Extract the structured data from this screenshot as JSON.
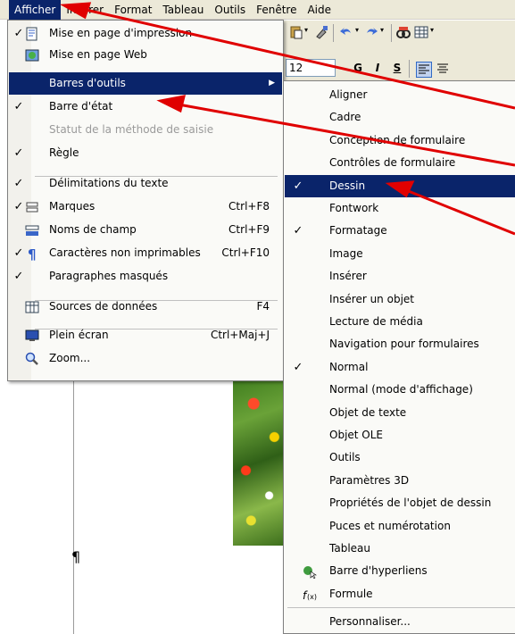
{
  "menubar": [
    "Afficher",
    "Insérer",
    "Format",
    "Tableau",
    "Outils",
    "Fenêtre",
    "Aide"
  ],
  "toolbar": {
    "font_size": "12",
    "bold": "G",
    "italic": "I",
    "strike": "S"
  },
  "doc": {
    "pilcrow": "¶"
  },
  "afficher_menu": [
    {
      "label": "Mise en page d'impression",
      "shortcut": "",
      "check": "✓",
      "icon": "print-layout-icon"
    },
    {
      "label": "Mise en page Web",
      "shortcut": "",
      "check": "",
      "icon": "web-layout-icon"
    },
    {
      "label": "Barres d'outils",
      "shortcut": "",
      "check": "",
      "icon": "",
      "submenu": true,
      "highlight": true
    },
    {
      "label": "Barre d'état",
      "shortcut": "",
      "check": "✓",
      "icon": ""
    },
    {
      "label": "Statut de la méthode de saisie",
      "shortcut": "",
      "check": "",
      "icon": "",
      "disabled": true
    },
    {
      "label": "Règle",
      "shortcut": "",
      "check": "✓",
      "icon": ""
    },
    {
      "label": "Délimitations du texte",
      "shortcut": "",
      "check": "✓",
      "icon": ""
    },
    {
      "label": "Marques",
      "shortcut": "Ctrl+F8",
      "check": "✓",
      "icon": "marks-icon"
    },
    {
      "label": "Noms de champ",
      "shortcut": "Ctrl+F9",
      "check": "",
      "icon": "field-names-icon"
    },
    {
      "label": "Caractères non imprimables",
      "shortcut": "Ctrl+F10",
      "check": "✓",
      "icon": "pilcrow-icon"
    },
    {
      "label": "Paragraphes masqués",
      "shortcut": "",
      "check": "✓",
      "icon": ""
    },
    {
      "label": "Sources de données",
      "shortcut": "F4",
      "check": "",
      "icon": "data-sources-icon"
    },
    {
      "label": "Plein écran",
      "shortcut": "Ctrl+Maj+J",
      "check": "",
      "icon": "fullscreen-icon"
    },
    {
      "label": "Zoom...",
      "shortcut": "",
      "check": "",
      "icon": "zoom-icon"
    }
  ],
  "barres_menu": [
    {
      "label": "Aligner",
      "check": ""
    },
    {
      "label": "Cadre",
      "check": ""
    },
    {
      "label": "Conception de formulaire",
      "check": ""
    },
    {
      "label": "Contrôles de formulaire",
      "check": ""
    },
    {
      "label": "Dessin",
      "check": "✓",
      "highlight": true
    },
    {
      "label": "Fontwork",
      "check": ""
    },
    {
      "label": "Formatage",
      "check": "✓"
    },
    {
      "label": "Image",
      "check": ""
    },
    {
      "label": "Insérer",
      "check": ""
    },
    {
      "label": "Insérer un objet",
      "check": ""
    },
    {
      "label": "Lecture de média",
      "check": ""
    },
    {
      "label": "Navigation pour formulaires",
      "check": ""
    },
    {
      "label": "Normal",
      "check": "✓"
    },
    {
      "label": "Normal (mode d'affichage)",
      "check": ""
    },
    {
      "label": "Objet de texte",
      "check": ""
    },
    {
      "label": "Objet OLE",
      "check": ""
    },
    {
      "label": "Outils",
      "check": ""
    },
    {
      "label": "Paramètres 3D",
      "check": ""
    },
    {
      "label": "Propriétés de l'objet de dessin",
      "check": ""
    },
    {
      "label": "Puces et numérotation",
      "check": ""
    },
    {
      "label": "Tableau",
      "check": ""
    },
    {
      "label": "Barre d'hyperliens",
      "check": "",
      "icon": "hyperlink-bar-icon"
    },
    {
      "label": "Formule",
      "check": "",
      "icon": "formula-icon"
    },
    {
      "label": "Personnaliser...",
      "check": ""
    }
  ],
  "colors": {
    "highlight": "#0a246a",
    "menubar": "#ece9d8",
    "arrow": "#e00000"
  }
}
